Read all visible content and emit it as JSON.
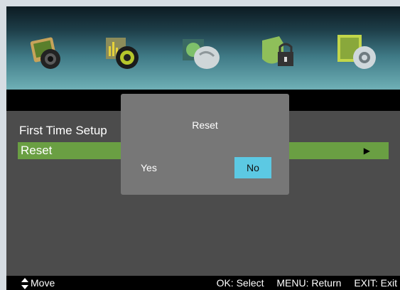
{
  "icons": [
    {
      "name": "picture-icon",
      "color": "#8f6a30"
    },
    {
      "name": "sound-icon",
      "color": "#6f7d25"
    },
    {
      "name": "channel-icon",
      "color": "#3c6c6f"
    },
    {
      "name": "lock-icon",
      "color": "#557a4b"
    },
    {
      "name": "setup-icon",
      "color": "#7aa843"
    }
  ],
  "menu": {
    "first_time_setup": "First Time Setup",
    "reset": "Reset",
    "selected_color": "#6a9f43"
  },
  "dialog": {
    "title": "Reset",
    "yes": "Yes",
    "no": "No",
    "focused_color": "#5cc9e3"
  },
  "footer": {
    "move": "Move",
    "ok": "OK: Select",
    "menu": "MENU: Return",
    "exit": "EXIT: Exit"
  }
}
